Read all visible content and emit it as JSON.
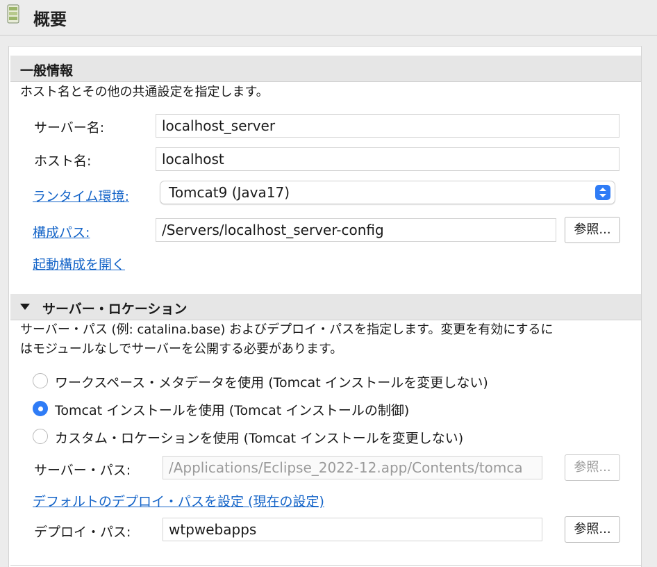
{
  "header": {
    "title": "概要",
    "icon": "server-icon"
  },
  "general": {
    "title": "一般情報",
    "description": "ホスト名とその他の共通設定を指定します。",
    "server_name_label": "サーバー名:",
    "server_name_value": "localhost_server",
    "host_name_label": "ホスト名:",
    "host_name_value": "localhost",
    "runtime_label": "ランタイム環境:",
    "runtime_value": "Tomcat9 (Java17)",
    "config_path_label": "構成パス:",
    "config_path_value": "/Servers/localhost_server-config",
    "browse_label": "参照...",
    "open_launch_config": "起動構成を開く"
  },
  "location": {
    "title": "サーバー・ロケーション",
    "description_line1": "サーバー・パス (例: catalina.base) およびデプロイ・パスを指定します。変更を有効にするに",
    "description_line2": "はモジュールなしでサーバーを公開する必要があります。",
    "options": [
      {
        "label": "ワークスペース・メタデータを使用 (Tomcat インストールを変更しない)",
        "checked": false
      },
      {
        "label": "Tomcat インストールを使用 (Tomcat インストールの制御)",
        "checked": true
      },
      {
        "label": "カスタム・ロケーションを使用 (Tomcat インストールを変更しない)",
        "checked": false
      }
    ],
    "server_path_label": "サーバー・パス:",
    "server_path_value": "/Applications/Eclipse_2022-12.app/Contents/tomca",
    "server_path_browse": "参照...",
    "set_default_link": "デフォルトのデプロイ・パスを設定 (現在の設定)",
    "deploy_path_label": "デプロイ・パス:",
    "deploy_path_value": "wtpwebapps",
    "deploy_path_browse": "参照..."
  },
  "colors": {
    "accent": "#2f7cf6",
    "link": "#1464c8"
  }
}
